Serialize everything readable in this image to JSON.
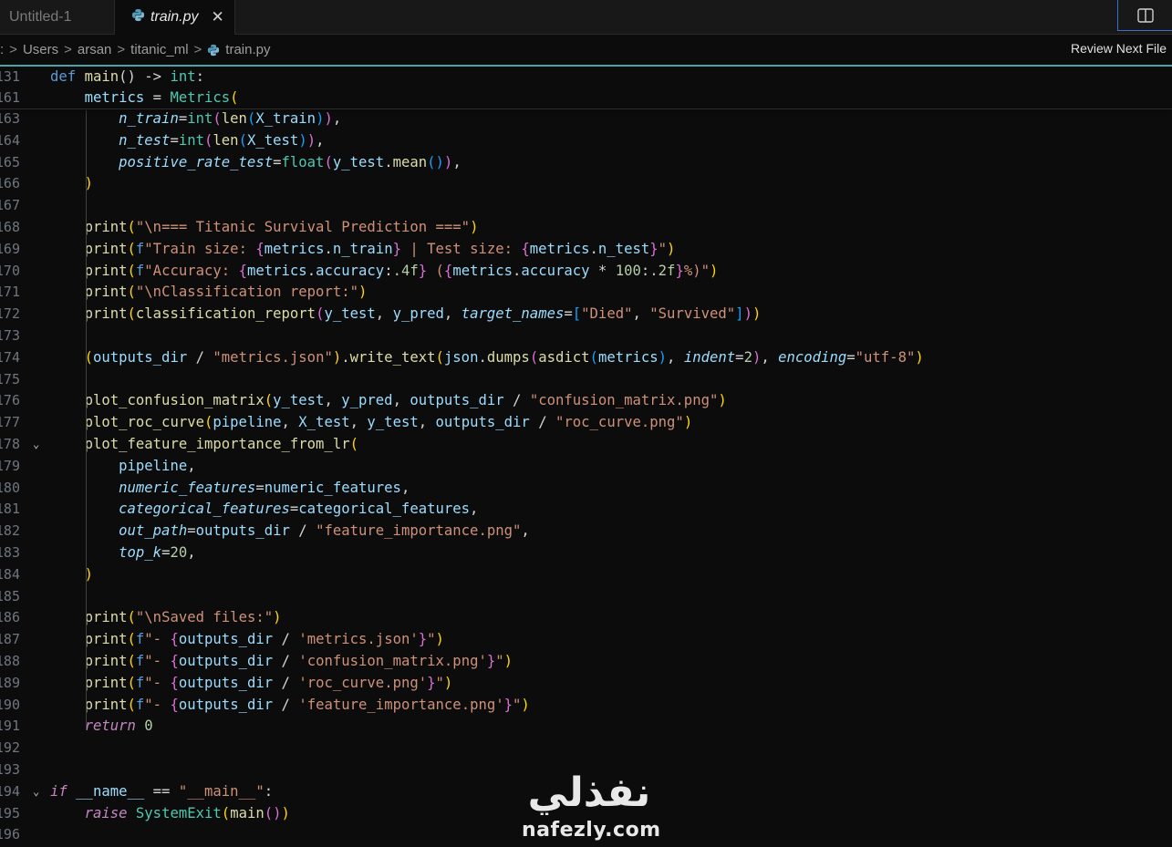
{
  "tabs": [
    {
      "label": "Untitled-1",
      "active": false
    },
    {
      "label": "train.py",
      "active": true,
      "close": "✕"
    }
  ],
  "breadcrumb": {
    "items": [
      ": ",
      "Users",
      "arsan",
      "titanic_ml",
      "train.py"
    ],
    "separator": ">"
  },
  "review_next_file": "Review Next File",
  "watermark": {
    "arabic": "نفذلي",
    "latin": "nafezly.com"
  },
  "colors": {
    "accent": "#4aa3a8",
    "background": "#0c0c0c",
    "split_border": "#3c6fd1"
  },
  "icons": [
    "python-file-icon",
    "close-icon",
    "split-editor-icon",
    "chevron-down-icon"
  ],
  "sticky": [
    {
      "ln": "131",
      "fold": false,
      "tokens": [
        [
          "k",
          "def"
        ],
        [
          "w",
          " "
        ],
        [
          "f",
          "main"
        ],
        [
          "w",
          "() -> "
        ],
        [
          "t",
          "int"
        ],
        [
          "w",
          ":"
        ]
      ]
    },
    {
      "ln": "161",
      "fold": false,
      "tokens": [
        [
          "w",
          "    "
        ],
        [
          "v",
          "metrics"
        ],
        [
          "w",
          " = "
        ],
        [
          "t",
          "Metrics"
        ],
        [
          "b1",
          "("
        ]
      ]
    }
  ],
  "lines": [
    {
      "ln": "163",
      "tokens": [
        [
          "w",
          "        "
        ],
        [
          "p",
          "n_train"
        ],
        [
          "w",
          "="
        ],
        [
          "t",
          "int"
        ],
        [
          "b2",
          "("
        ],
        [
          "f",
          "len"
        ],
        [
          "b3",
          "("
        ],
        [
          "v",
          "X_train"
        ],
        [
          "b3",
          ")"
        ],
        [
          "b2",
          ")"
        ],
        [
          "w",
          ","
        ]
      ]
    },
    {
      "ln": "164",
      "tokens": [
        [
          "w",
          "        "
        ],
        [
          "p",
          "n_test"
        ],
        [
          "w",
          "="
        ],
        [
          "t",
          "int"
        ],
        [
          "b2",
          "("
        ],
        [
          "f",
          "len"
        ],
        [
          "b3",
          "("
        ],
        [
          "v",
          "X_test"
        ],
        [
          "b3",
          ")"
        ],
        [
          "b2",
          ")"
        ],
        [
          "w",
          ","
        ]
      ]
    },
    {
      "ln": "165",
      "tokens": [
        [
          "w",
          "        "
        ],
        [
          "p",
          "positive_rate_test"
        ],
        [
          "w",
          "="
        ],
        [
          "t",
          "float"
        ],
        [
          "b2",
          "("
        ],
        [
          "v",
          "y_test"
        ],
        [
          "w",
          "."
        ],
        [
          "f",
          "mean"
        ],
        [
          "b3",
          "()"
        ],
        [
          "b2",
          ")"
        ],
        [
          "w",
          ","
        ]
      ]
    },
    {
      "ln": "166",
      "tokens": [
        [
          "w",
          "    "
        ],
        [
          "b1",
          ")"
        ]
      ]
    },
    {
      "ln": "167",
      "tokens": []
    },
    {
      "ln": "168",
      "tokens": [
        [
          "w",
          "    "
        ],
        [
          "f",
          "print"
        ],
        [
          "b1",
          "("
        ],
        [
          "s",
          "\"\\n=== Titanic Survival Prediction ===\""
        ],
        [
          "b1",
          ")"
        ]
      ]
    },
    {
      "ln": "169",
      "tokens": [
        [
          "w",
          "    "
        ],
        [
          "f",
          "print"
        ],
        [
          "b1",
          "("
        ],
        [
          "k",
          "f"
        ],
        [
          "s",
          "\"Train size: "
        ],
        [
          "b2",
          "{"
        ],
        [
          "v",
          "metrics"
        ],
        [
          "w",
          "."
        ],
        [
          "v",
          "n_train"
        ],
        [
          "b2",
          "}"
        ],
        [
          "s",
          " | Test size: "
        ],
        [
          "b2",
          "{"
        ],
        [
          "v",
          "metrics"
        ],
        [
          "w",
          "."
        ],
        [
          "v",
          "n_test"
        ],
        [
          "b2",
          "}"
        ],
        [
          "s",
          "\""
        ],
        [
          "b1",
          ")"
        ]
      ]
    },
    {
      "ln": "170",
      "tokens": [
        [
          "w",
          "    "
        ],
        [
          "f",
          "print"
        ],
        [
          "b1",
          "("
        ],
        [
          "k",
          "f"
        ],
        [
          "s",
          "\"Accuracy: "
        ],
        [
          "b2",
          "{"
        ],
        [
          "v",
          "metrics"
        ],
        [
          "w",
          "."
        ],
        [
          "v",
          "accuracy"
        ],
        [
          "w",
          ":"
        ],
        [
          "n",
          ".4f"
        ],
        [
          "b2",
          "}"
        ],
        [
          "s",
          " ("
        ],
        [
          "b2",
          "{"
        ],
        [
          "v",
          "metrics"
        ],
        [
          "w",
          "."
        ],
        [
          "v",
          "accuracy"
        ],
        [
          "w",
          " * "
        ],
        [
          "n",
          "100"
        ],
        [
          "w",
          ":"
        ],
        [
          "n",
          ".2f"
        ],
        [
          "b2",
          "}"
        ],
        [
          "s",
          "%)\""
        ],
        [
          "b1",
          ")"
        ]
      ]
    },
    {
      "ln": "171",
      "tokens": [
        [
          "w",
          "    "
        ],
        [
          "f",
          "print"
        ],
        [
          "b1",
          "("
        ],
        [
          "s",
          "\"\\nClassification report:\""
        ],
        [
          "b1",
          ")"
        ]
      ]
    },
    {
      "ln": "172",
      "tokens": [
        [
          "w",
          "    "
        ],
        [
          "f",
          "print"
        ],
        [
          "b1",
          "("
        ],
        [
          "f",
          "classification_report"
        ],
        [
          "b2",
          "("
        ],
        [
          "v",
          "y_test"
        ],
        [
          "w",
          ", "
        ],
        [
          "v",
          "y_pred"
        ],
        [
          "w",
          ", "
        ],
        [
          "p",
          "target_names"
        ],
        [
          "w",
          "="
        ],
        [
          "b3",
          "["
        ],
        [
          "s",
          "\"Died\""
        ],
        [
          "w",
          ", "
        ],
        [
          "s",
          "\"Survived\""
        ],
        [
          "b3",
          "]"
        ],
        [
          "b2",
          ")"
        ],
        [
          "b1",
          ")"
        ]
      ]
    },
    {
      "ln": "173",
      "tokens": []
    },
    {
      "ln": "174",
      "tokens": [
        [
          "w",
          "    "
        ],
        [
          "b1",
          "("
        ],
        [
          "v",
          "outputs_dir"
        ],
        [
          "w",
          " / "
        ],
        [
          "s",
          "\"metrics.json\""
        ],
        [
          "b1",
          ")"
        ],
        [
          "w",
          "."
        ],
        [
          "f",
          "write_text"
        ],
        [
          "b1",
          "("
        ],
        [
          "v",
          "json"
        ],
        [
          "w",
          "."
        ],
        [
          "f",
          "dumps"
        ],
        [
          "b2",
          "("
        ],
        [
          "f",
          "asdict"
        ],
        [
          "b3",
          "("
        ],
        [
          "v",
          "metrics"
        ],
        [
          "b3",
          ")"
        ],
        [
          "w",
          ", "
        ],
        [
          "p",
          "indent"
        ],
        [
          "w",
          "="
        ],
        [
          "n",
          "2"
        ],
        [
          "b2",
          ")"
        ],
        [
          "w",
          ", "
        ],
        [
          "p",
          "encoding"
        ],
        [
          "w",
          "="
        ],
        [
          "s",
          "\"utf-8\""
        ],
        [
          "b1",
          ")"
        ]
      ]
    },
    {
      "ln": "175",
      "tokens": []
    },
    {
      "ln": "176",
      "tokens": [
        [
          "w",
          "    "
        ],
        [
          "f",
          "plot_confusion_matrix"
        ],
        [
          "b1",
          "("
        ],
        [
          "v",
          "y_test"
        ],
        [
          "w",
          ", "
        ],
        [
          "v",
          "y_pred"
        ],
        [
          "w",
          ", "
        ],
        [
          "v",
          "outputs_dir"
        ],
        [
          "w",
          " / "
        ],
        [
          "s",
          "\"confusion_matrix.png\""
        ],
        [
          "b1",
          ")"
        ]
      ]
    },
    {
      "ln": "177",
      "tokens": [
        [
          "w",
          "    "
        ],
        [
          "f",
          "plot_roc_curve"
        ],
        [
          "b1",
          "("
        ],
        [
          "v",
          "pipeline"
        ],
        [
          "w",
          ", "
        ],
        [
          "v",
          "X_test"
        ],
        [
          "w",
          ", "
        ],
        [
          "v",
          "y_test"
        ],
        [
          "w",
          ", "
        ],
        [
          "v",
          "outputs_dir"
        ],
        [
          "w",
          " / "
        ],
        [
          "s",
          "\"roc_curve.png\""
        ],
        [
          "b1",
          ")"
        ]
      ]
    },
    {
      "ln": "178",
      "fold": true,
      "tokens": [
        [
          "w",
          "    "
        ],
        [
          "f",
          "plot_feature_importance_from_lr"
        ],
        [
          "b1",
          "("
        ]
      ]
    },
    {
      "ln": "179",
      "tokens": [
        [
          "w",
          "        "
        ],
        [
          "v",
          "pipeline"
        ],
        [
          "w",
          ","
        ]
      ]
    },
    {
      "ln": "180",
      "tokens": [
        [
          "w",
          "        "
        ],
        [
          "p",
          "numeric_features"
        ],
        [
          "w",
          "="
        ],
        [
          "v",
          "numeric_features"
        ],
        [
          "w",
          ","
        ]
      ]
    },
    {
      "ln": "181",
      "tokens": [
        [
          "w",
          "        "
        ],
        [
          "p",
          "categorical_features"
        ],
        [
          "w",
          "="
        ],
        [
          "v",
          "categorical_features"
        ],
        [
          "w",
          ","
        ]
      ]
    },
    {
      "ln": "182",
      "tokens": [
        [
          "w",
          "        "
        ],
        [
          "p",
          "out_path"
        ],
        [
          "w",
          "="
        ],
        [
          "v",
          "outputs_dir"
        ],
        [
          "w",
          " / "
        ],
        [
          "s",
          "\"feature_importance.png\""
        ],
        [
          "w",
          ","
        ]
      ]
    },
    {
      "ln": "183",
      "tokens": [
        [
          "w",
          "        "
        ],
        [
          "p",
          "top_k"
        ],
        [
          "w",
          "="
        ],
        [
          "n",
          "20"
        ],
        [
          "w",
          ","
        ]
      ]
    },
    {
      "ln": "184",
      "tokens": [
        [
          "w",
          "    "
        ],
        [
          "b1",
          ")"
        ]
      ]
    },
    {
      "ln": "185",
      "tokens": []
    },
    {
      "ln": "186",
      "tokens": [
        [
          "w",
          "    "
        ],
        [
          "f",
          "print"
        ],
        [
          "b1",
          "("
        ],
        [
          "s",
          "\"\\nSaved files:\""
        ],
        [
          "b1",
          ")"
        ]
      ]
    },
    {
      "ln": "187",
      "tokens": [
        [
          "w",
          "    "
        ],
        [
          "f",
          "print"
        ],
        [
          "b1",
          "("
        ],
        [
          "k",
          "f"
        ],
        [
          "s",
          "\"- "
        ],
        [
          "b2",
          "{"
        ],
        [
          "v",
          "outputs_dir"
        ],
        [
          "w",
          " / "
        ],
        [
          "s",
          "'metrics.json'"
        ],
        [
          "b2",
          "}"
        ],
        [
          "s",
          "\""
        ],
        [
          "b1",
          ")"
        ]
      ]
    },
    {
      "ln": "188",
      "tokens": [
        [
          "w",
          "    "
        ],
        [
          "f",
          "print"
        ],
        [
          "b1",
          "("
        ],
        [
          "k",
          "f"
        ],
        [
          "s",
          "\"- "
        ],
        [
          "b2",
          "{"
        ],
        [
          "v",
          "outputs_dir"
        ],
        [
          "w",
          " / "
        ],
        [
          "s",
          "'confusion_matrix.png'"
        ],
        [
          "b2",
          "}"
        ],
        [
          "s",
          "\""
        ],
        [
          "b1",
          ")"
        ]
      ]
    },
    {
      "ln": "189",
      "tokens": [
        [
          "w",
          "    "
        ],
        [
          "f",
          "print"
        ],
        [
          "b1",
          "("
        ],
        [
          "k",
          "f"
        ],
        [
          "s",
          "\"- "
        ],
        [
          "b2",
          "{"
        ],
        [
          "v",
          "outputs_dir"
        ],
        [
          "w",
          " / "
        ],
        [
          "s",
          "'roc_curve.png'"
        ],
        [
          "b2",
          "}"
        ],
        [
          "s",
          "\""
        ],
        [
          "b1",
          ")"
        ]
      ]
    },
    {
      "ln": "190",
      "tokens": [
        [
          "w",
          "    "
        ],
        [
          "f",
          "print"
        ],
        [
          "b1",
          "("
        ],
        [
          "k",
          "f"
        ],
        [
          "s",
          "\"- "
        ],
        [
          "b2",
          "{"
        ],
        [
          "v",
          "outputs_dir"
        ],
        [
          "w",
          " / "
        ],
        [
          "s",
          "'feature_importance.png'"
        ],
        [
          "b2",
          "}"
        ],
        [
          "s",
          "\""
        ],
        [
          "b1",
          ")"
        ]
      ]
    },
    {
      "ln": "191",
      "tokens": [
        [
          "w",
          "    "
        ],
        [
          "c",
          "return"
        ],
        [
          "w",
          " "
        ],
        [
          "n",
          "0"
        ]
      ]
    },
    {
      "ln": "192",
      "tokens": []
    },
    {
      "ln": "193",
      "tokens": []
    },
    {
      "ln": "194",
      "fold": true,
      "tokens": [
        [
          "c",
          "if"
        ],
        [
          "w",
          " "
        ],
        [
          "v",
          "__name__"
        ],
        [
          "w",
          " == "
        ],
        [
          "s",
          "\"__main__\""
        ],
        [
          "w",
          ":"
        ]
      ]
    },
    {
      "ln": "195",
      "tokens": [
        [
          "w",
          "    "
        ],
        [
          "c",
          "raise"
        ],
        [
          "w",
          " "
        ],
        [
          "t",
          "SystemExit"
        ],
        [
          "b1",
          "("
        ],
        [
          "f",
          "main"
        ],
        [
          "b2",
          "()"
        ],
        [
          "b1",
          ")"
        ]
      ]
    },
    {
      "ln": "196",
      "tokens": []
    }
  ]
}
